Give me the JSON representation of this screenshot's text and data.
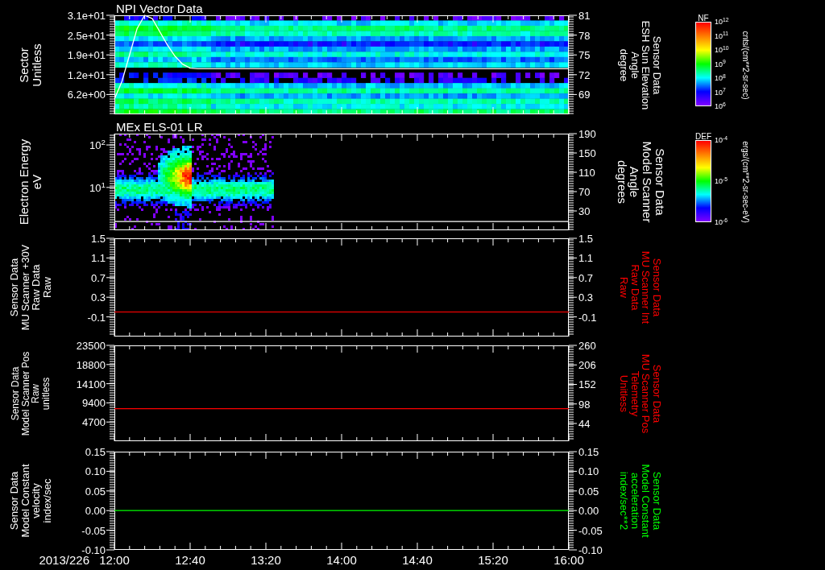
{
  "panels": [
    {
      "kind": "sector_spectrogram",
      "title": "NPI Vector Data",
      "left_label": [
        "Sector",
        "Unitless"
      ],
      "left_axis": {
        "kind": "linear",
        "ticks": [
          "3.1e+01",
          "2.5e+01",
          "1.9e+01",
          "1.2e+01",
          "6.2e+00"
        ]
      },
      "right_label": {
        "lines": [
          "Sensor Data",
          "ESH Sun Elevation",
          "Angle",
          "degree"
        ],
        "color": "#ffffff"
      },
      "chart_data": {
        "type": "line",
        "x": [
          12,
          12.0667,
          12.1333,
          12.2,
          12.2667,
          12.3333,
          12.4,
          12.4667,
          12.5333,
          12.6,
          12.6667,
          12.7333,
          16
        ],
        "xlim": [
          12,
          16
        ],
        "ylim": [
          66,
          81
        ],
        "yticks": [
          {
            "value": 81,
            "label": "81"
          },
          {
            "value": 78,
            "label": "78"
          },
          {
            "value": 75,
            "label": "75"
          },
          {
            "value": 72,
            "label": "72"
          },
          {
            "value": 69,
            "label": "69"
          }
        ],
        "series": [
          {
            "color": "#ffffff",
            "values": [
              68.3,
              71,
              75,
              79,
              81,
              80.5,
              78.5,
              76.5,
              74.8,
              73.6,
              73,
              72.9,
              72.9
            ]
          }
        ]
      },
      "colorbar": {
        "title": "NF",
        "ticks": [
          "10$^{12}$",
          "10$^{11}$",
          "10$^{10}$",
          "10$^{9}$",
          "10$^{8}$",
          "10$^{7}$",
          "10$^{6}$"
        ],
        "units": "cnts/(cm**2-sr-sec)"
      }
    },
    {
      "kind": "energy_spectrogram",
      "title": "MEx ELS-01 LR",
      "left_label": [
        "Electron Energy",
        "eV"
      ],
      "left_axis": {
        "kind": "log",
        "ticks": [
          "10$^{2}$",
          "10$^{1}$"
        ]
      },
      "right_label": {
        "lines": [
          "Sensor Data",
          "Model Scanner",
          "Angle",
          "degrees"
        ],
        "color": "#ffffff"
      },
      "chart_data": {
        "type": "line",
        "x": [
          12,
          16
        ],
        "xlim": [
          12,
          16
        ],
        "ylim": [
          -10,
          190
        ],
        "yticks": [
          {
            "value": 190,
            "label": "190"
          },
          {
            "value": 150,
            "label": "150"
          },
          {
            "value": 110,
            "label": "110"
          },
          {
            "value": 70,
            "label": "70"
          },
          {
            "value": 30,
            "label": "30"
          }
        ],
        "series": [
          {
            "color": "#ffffff",
            "values": [
              8,
              8
            ]
          }
        ]
      },
      "colorbar": {
        "title": "DEF",
        "ticks": [
          "10$^{-4}$",
          "10$^{-5}$",
          "10$^{-6}$"
        ],
        "units": "ergs/(cm**2-sr-sec-eV)"
      }
    },
    {
      "kind": "line_plot",
      "left_label": [
        "Sensor Data",
        "MU Scanner +30V",
        "Raw Data",
        "Raw"
      ],
      "left_axis": {
        "kind": "linear",
        "ticks": [
          "1.5",
          "1.1",
          "0.7",
          "0.3",
          "-0.1"
        ]
      },
      "right_label": {
        "lines": [
          "Sensor Data",
          "MU Scanner Int",
          "Raw Data",
          "Raw"
        ],
        "color": "#ff0000"
      },
      "chart_data": {
        "type": "line",
        "x": [
          12,
          16
        ],
        "xlim": [
          12,
          16
        ],
        "ylim": [
          -0.5,
          1.5
        ],
        "yticks": [
          {
            "value": 1.5,
            "label": "1.5"
          },
          {
            "value": 1.1,
            "label": "1.1"
          },
          {
            "value": 0.7,
            "label": "0.7"
          },
          {
            "value": 0.3,
            "label": "0.3"
          },
          {
            "value": -0.1,
            "label": "-0.1"
          }
        ],
        "series": [
          {
            "color": "#d00000",
            "values": [
              0.0,
              0.0
            ]
          }
        ]
      }
    },
    {
      "kind": "line_plot",
      "left_label": [
        "Sensor Data",
        "Model Scanner Pos",
        "Raw",
        "unitless"
      ],
      "left_axis": {
        "kind": "linear",
        "ticks": [
          "23500",
          "18800",
          "14100",
          "9400",
          "4700"
        ]
      },
      "right_label": {
        "lines": [
          "Sensor Data",
          "MU Scanner Pos",
          "Telemetry",
          "Unitless"
        ],
        "color": "#ff0000"
      },
      "chart_data": {
        "type": "line",
        "x": [
          12,
          16
        ],
        "xlim": [
          12,
          16
        ],
        "ylim": [
          -5,
          260
        ],
        "yticks": [
          {
            "value": 260,
            "label": "260"
          },
          {
            "value": 206,
            "label": "206"
          },
          {
            "value": 152,
            "label": "152"
          },
          {
            "value": 98,
            "label": "98"
          },
          {
            "value": 44,
            "label": "44"
          }
        ],
        "series": [
          {
            "color": "#ff0000",
            "values": [
              85,
              85
            ]
          }
        ]
      }
    },
    {
      "kind": "line_plot",
      "left_label": [
        "Sensor Data",
        "Model Constant",
        "velocity",
        "index/sec"
      ],
      "left_axis": {
        "kind": "linear",
        "ticks": [
          "0.15",
          "0.10",
          "0.05",
          "0.00",
          "-0.05",
          "-0.10"
        ]
      },
      "right_label": {
        "lines": [
          "Sensor Data",
          "Model Constant",
          "acceleration",
          "index/sec**2"
        ],
        "color": "#00ff00"
      },
      "chart_data": {
        "type": "line",
        "x": [
          12,
          16
        ],
        "xlim": [
          12,
          16
        ],
        "ylim": [
          -0.1,
          0.15
        ],
        "yticks": [
          {
            "value": 0.15,
            "label": "0.15"
          },
          {
            "value": 0.1,
            "label": "0.10"
          },
          {
            "value": 0.05,
            "label": "0.05"
          },
          {
            "value": 0,
            "label": "0.00"
          },
          {
            "value": -0.05,
            "label": "-0.05"
          },
          {
            "value": -0.1,
            "label": "-0.10"
          }
        ],
        "xticks": [
          {
            "value": 12,
            "label": "12:00"
          },
          {
            "value": 12.6667,
            "label": "12:40"
          },
          {
            "value": 13.3333,
            "label": "13:20"
          },
          {
            "value": 14,
            "label": "14:00"
          },
          {
            "value": 14.6667,
            "label": "14:40"
          },
          {
            "value": 15.3333,
            "label": "15:20"
          },
          {
            "value": 16,
            "label": "16:00"
          }
        ],
        "series": [
          {
            "color": "#00ff00",
            "values": [
              0,
              0
            ]
          }
        ]
      }
    }
  ],
  "date_label": "2013/226"
}
